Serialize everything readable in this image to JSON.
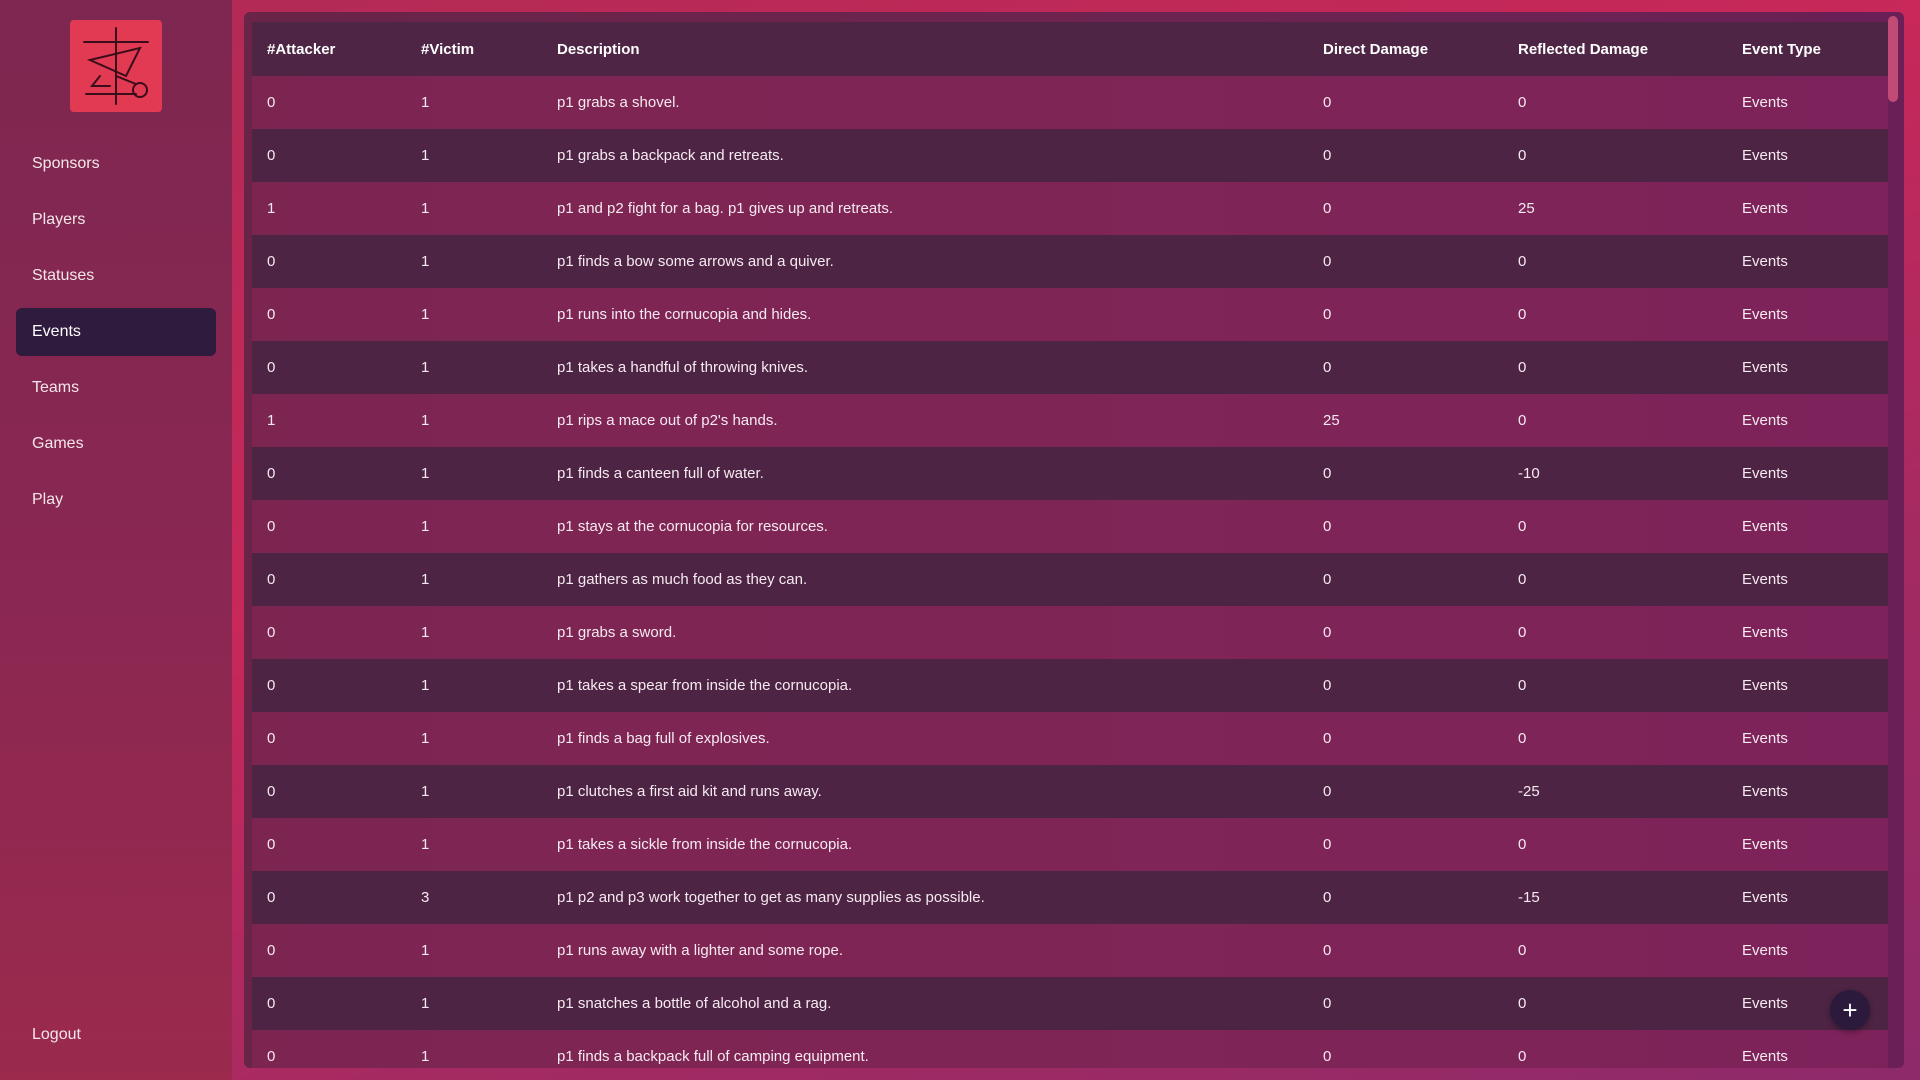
{
  "sidebar": {
    "logo": "logo-emblem",
    "items": [
      {
        "label": "Sponsors"
      },
      {
        "label": "Players"
      },
      {
        "label": "Statuses"
      },
      {
        "label": "Events",
        "active": true
      },
      {
        "label": "Teams"
      },
      {
        "label": "Games"
      },
      {
        "label": "Play"
      }
    ],
    "logout_label": "Logout"
  },
  "table": {
    "headers": [
      "#Attacker",
      "#Victim",
      "Description",
      "Direct Damage",
      "Reflected Damage",
      "Event Type"
    ],
    "rows": [
      [
        "0",
        "1",
        "p1 grabs a shovel.",
        "0",
        "0",
        "Events"
      ],
      [
        "0",
        "1",
        "p1 grabs a backpack and retreats.",
        "0",
        "0",
        "Events"
      ],
      [
        "1",
        "1",
        "p1 and p2 fight for a bag. p1 gives up and retreats.",
        "0",
        "25",
        "Events"
      ],
      [
        "0",
        "1",
        "p1 finds a bow some arrows and a quiver.",
        "0",
        "0",
        "Events"
      ],
      [
        "0",
        "1",
        "p1 runs into the cornucopia and hides.",
        "0",
        "0",
        "Events"
      ],
      [
        "0",
        "1",
        "p1 takes a handful of throwing knives.",
        "0",
        "0",
        "Events"
      ],
      [
        "1",
        "1",
        "p1 rips a mace out of p2's hands.",
        "25",
        "0",
        "Events"
      ],
      [
        "0",
        "1",
        "p1 finds a canteen full of water.",
        "0",
        "-10",
        "Events"
      ],
      [
        "0",
        "1",
        "p1 stays at the cornucopia for resources.",
        "0",
        "0",
        "Events"
      ],
      [
        "0",
        "1",
        "p1 gathers as much food as they can.",
        "0",
        "0",
        "Events"
      ],
      [
        "0",
        "1",
        "p1 grabs a sword.",
        "0",
        "0",
        "Events"
      ],
      [
        "0",
        "1",
        "p1 takes a spear from inside the cornucopia.",
        "0",
        "0",
        "Events"
      ],
      [
        "0",
        "1",
        "p1 finds a bag full of explosives.",
        "0",
        "0",
        "Events"
      ],
      [
        "0",
        "1",
        "p1 clutches a first aid kit and runs away.",
        "0",
        "-25",
        "Events"
      ],
      [
        "0",
        "1",
        "p1 takes a sickle from inside the cornucopia.",
        "0",
        "0",
        "Events"
      ],
      [
        "0",
        "3",
        "p1 p2 and p3 work together to get as many supplies as possible.",
        "0",
        "-15",
        "Events"
      ],
      [
        "0",
        "1",
        "p1 runs away with a lighter and some rope.",
        "0",
        "0",
        "Events"
      ],
      [
        "0",
        "1",
        "p1 snatches a bottle of alcohol and a rag.",
        "0",
        "0",
        "Events"
      ],
      [
        "0",
        "1",
        "p1 finds a backpack full of camping equipment.",
        "0",
        "0",
        "Events"
      ]
    ]
  },
  "fab": {
    "icon": "plus-icon",
    "label": "+"
  },
  "colors": {
    "accent": "#e23a52",
    "active_nav": "#2e1b3d"
  }
}
